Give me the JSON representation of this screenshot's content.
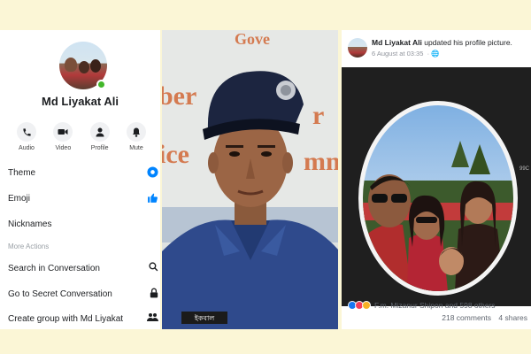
{
  "left_panel": {
    "profile_name": "Md Liyakat Ali",
    "quick_actions": [
      {
        "label": "Audio",
        "icon": "phone-icon"
      },
      {
        "label": "Video",
        "icon": "video-camera-icon"
      },
      {
        "label": "Profile",
        "icon": "person-icon"
      },
      {
        "label": "Mute",
        "icon": "bell-icon"
      }
    ],
    "menu": {
      "theme": "Theme",
      "emoji": "Emoji",
      "nicknames": "Nicknames",
      "more_actions": "More Actions",
      "search": "Search in Conversation",
      "secret": "Go to Secret Conversation",
      "create_group": "Create group with Md Liyakat"
    },
    "colors": {
      "accent": "#0084ff",
      "online": "#42b72a"
    }
  },
  "middle_photo": {
    "badge_text": "ইকবাল",
    "signboard_letters": [
      "Gove",
      "ber",
      "r",
      "ice",
      "mm"
    ]
  },
  "right_panel": {
    "author": "Md Liyakat Ali",
    "action": "updated his profile picture.",
    "date": "6 August at 03:35",
    "small_label": "99C",
    "reactions_text": "F.m. Mizanur Shipon and 598 others",
    "comments": "218 comments",
    "shares": "4 shares",
    "reaction_colors": [
      "#1877f2",
      "#f33e58",
      "#f7b125"
    ]
  }
}
